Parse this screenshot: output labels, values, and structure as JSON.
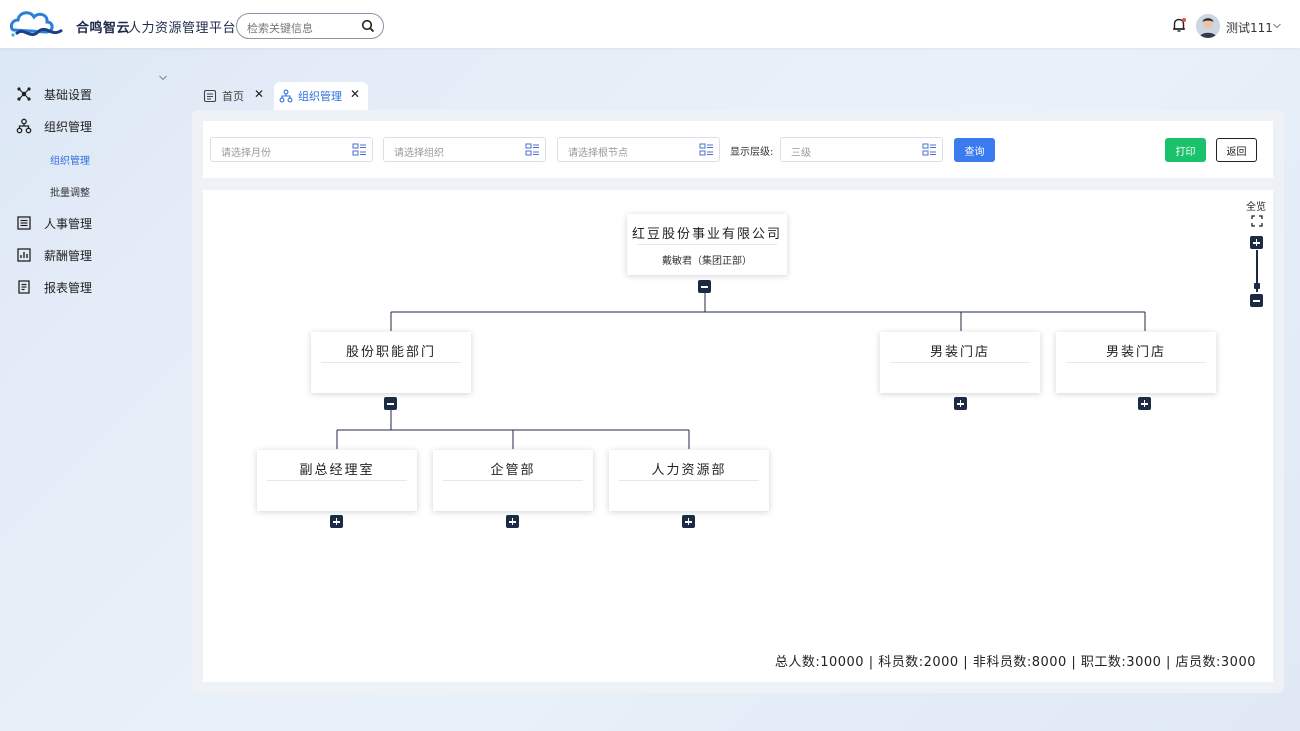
{
  "header": {
    "brand": "合鸣智云",
    "platform": "人力资源管理平台",
    "search_placeholder": "检索关键信息",
    "username": "测试111",
    "icons": [
      "logo",
      "search-icon",
      "bell-icon",
      "avatar",
      "chevron-down-icon"
    ]
  },
  "sidebar": {
    "items": [
      {
        "label": "基础设置",
        "icon": "settings-network-icon"
      },
      {
        "label": "组织管理",
        "icon": "org-chart-icon",
        "expanded": true
      },
      {
        "label": "人事管理",
        "icon": "personnel-icon"
      },
      {
        "label": "薪酬管理",
        "icon": "salary-chart-icon"
      },
      {
        "label": "报表管理",
        "icon": "report-icon"
      }
    ],
    "subitems": [
      {
        "label": "组织管理",
        "active": true
      },
      {
        "label": "批量调整",
        "active": false
      }
    ]
  },
  "tabs": [
    {
      "label": "首页",
      "icon": "document-icon",
      "active": false
    },
    {
      "label": "组织管理",
      "icon": "org-chart-icon",
      "active": true
    }
  ],
  "filters": {
    "month_placeholder": "请选择月份",
    "org_placeholder": "请选择组织",
    "root_placeholder": "请选择根节点",
    "level_label": "显示层级:",
    "level_value": "三级",
    "query_button": "查询",
    "print_button": "打印",
    "back_button": "返回"
  },
  "org_chart": {
    "root": {
      "title": "红豆股份事业有限公司",
      "subtitle": "戴敏君（集团正部）",
      "expanded": true
    },
    "level2": [
      {
        "title": "股份职能部门",
        "subtitle": "",
        "expanded": true
      },
      {
        "title": "男装门店",
        "subtitle": "",
        "expanded": false
      },
      {
        "title": "男装门店",
        "subtitle": "",
        "expanded": false
      }
    ],
    "level3": [
      {
        "title": "副总经理室",
        "subtitle": "",
        "expanded": false
      },
      {
        "title": "企管部",
        "subtitle": "",
        "expanded": false
      },
      {
        "title": "人力资源部",
        "subtitle": "",
        "expanded": false
      }
    ],
    "zoom": {
      "label": "全览",
      "icons": [
        "fullscreen-icon",
        "zoom-in-icon",
        "zoom-out-icon"
      ],
      "level": 0.2
    }
  },
  "stats": "总人数:10000 | 科员数:2000 | 非科员数:8000 | 职工数:3000 | 店员数:3000"
}
